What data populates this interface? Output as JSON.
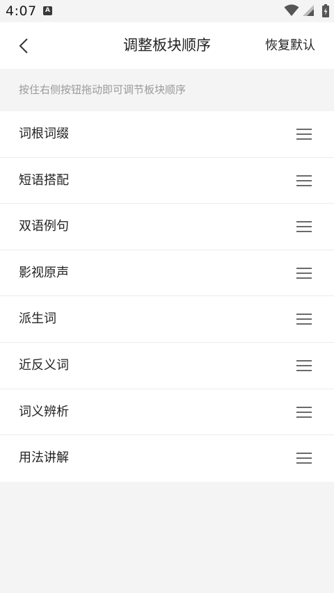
{
  "status_bar": {
    "time": "4:07",
    "app_icon_letter": "A",
    "icons": [
      "wifi-icon",
      "signal-icon",
      "battery-icon"
    ]
  },
  "app_bar": {
    "title": "调整板块顺序",
    "back_icon": "chevron-left-icon",
    "restore_label": "恢复默认"
  },
  "hint": "按住右侧按钮拖动即可调节板块顺序",
  "sections": [
    {
      "label": "词根词缀"
    },
    {
      "label": "短语搭配"
    },
    {
      "label": "双语例句"
    },
    {
      "label": "影视原声"
    },
    {
      "label": "派生词"
    },
    {
      "label": "近反义词"
    },
    {
      "label": "词义辨析"
    },
    {
      "label": "用法讲解"
    }
  ],
  "colors": {
    "background": "#f4f4f4",
    "surface": "#ffffff",
    "text_primary": "#222222",
    "text_hint": "#9a9a9a",
    "handle": "#6a6a6a"
  }
}
